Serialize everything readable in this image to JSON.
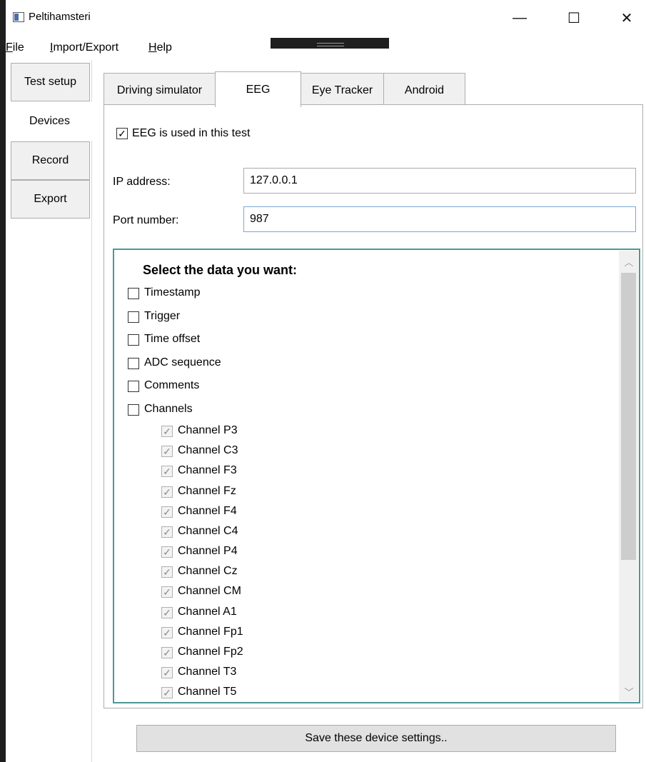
{
  "window": {
    "title": "Peltihamsteri",
    "controls": {
      "minimize": "—",
      "maximize": "☐",
      "close": "✕"
    }
  },
  "menubar": {
    "items": [
      {
        "label_ul": "F",
        "label_rest": "ile"
      },
      {
        "label_ul": "I",
        "label_rest": "mport/Export"
      },
      {
        "label_ul": "H",
        "label_rest": "elp"
      }
    ]
  },
  "main_tabs": [
    {
      "label": "Test setup",
      "selected": false
    },
    {
      "label": "Devices",
      "selected": true
    },
    {
      "label": "Record",
      "selected": false
    },
    {
      "label": "Export",
      "selected": false
    }
  ],
  "device_tabs": [
    {
      "label": "Driving simulator",
      "selected": false
    },
    {
      "label": "EEG",
      "selected": true
    },
    {
      "label": "Eye Tracker",
      "selected": false
    },
    {
      "label": "Android",
      "selected": false
    }
  ],
  "eeg": {
    "use_checkbox": {
      "label": "EEG is used in this test",
      "checked": true,
      "mark": "✓"
    },
    "ip": {
      "label": "IP address:",
      "value": "127.0.0.1"
    },
    "port": {
      "label": "Port number:",
      "value": "987"
    },
    "data_list": {
      "heading": "Select the data you want:",
      "options": [
        {
          "label": "Timestamp",
          "checked": false
        },
        {
          "label": "Trigger",
          "checked": false
        },
        {
          "label": "Time offset",
          "checked": false
        },
        {
          "label": "ADC sequence",
          "checked": false
        },
        {
          "label": "Comments",
          "checked": false
        },
        {
          "label": "Channels",
          "checked": false
        }
      ],
      "channel_mark": "✓",
      "channels": [
        "Channel P3",
        "Channel C3",
        "Channel F3",
        "Channel Fz",
        "Channel F4",
        "Channel C4",
        "Channel P4",
        "Channel Cz",
        "Channel CM",
        "Channel A1",
        "Channel Fp1",
        "Channel Fp2",
        "Channel T3",
        "Channel T5"
      ]
    },
    "save_button": "Save these device settings.."
  }
}
